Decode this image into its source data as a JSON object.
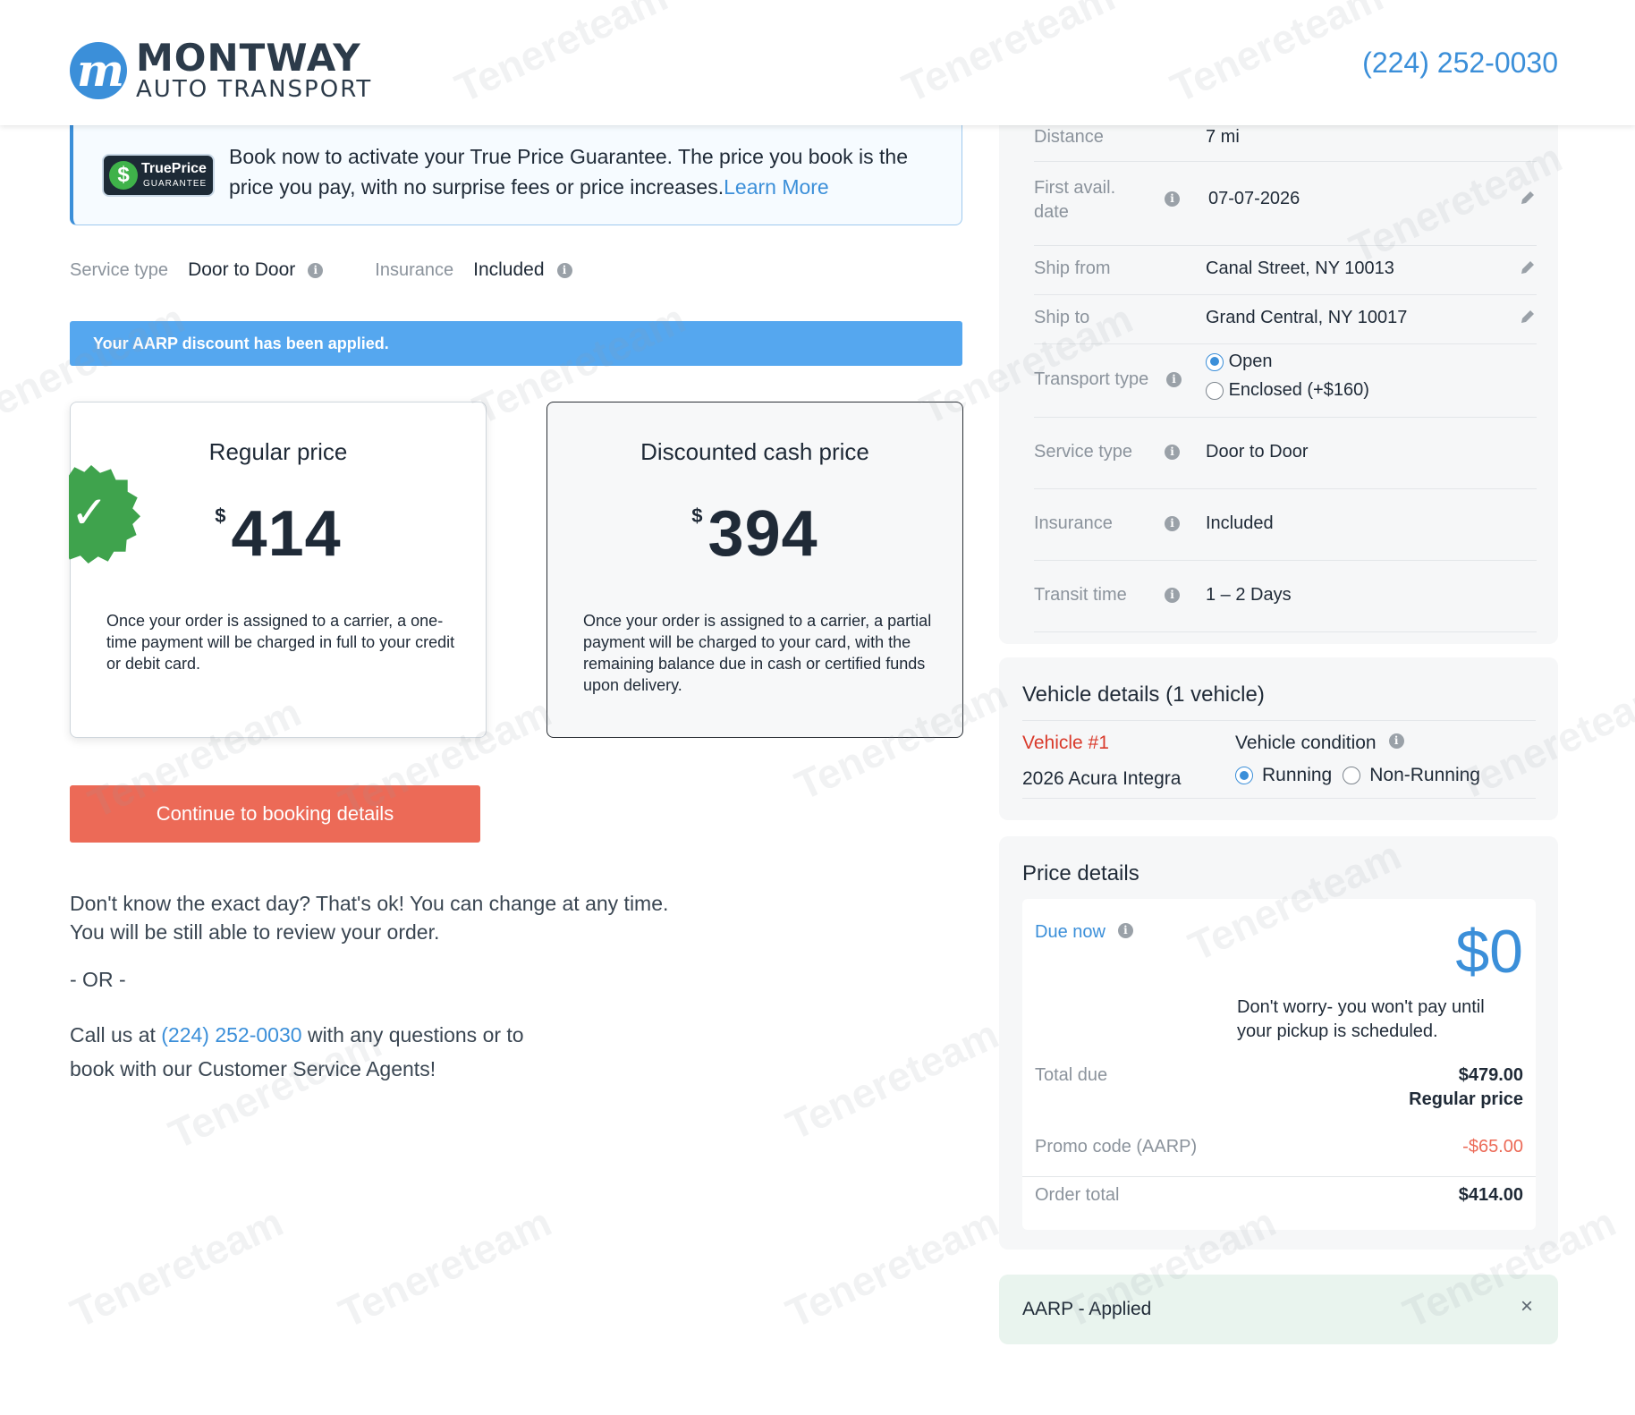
{
  "header": {
    "brand_name": "MONTWAY",
    "brand_sub": "AUTO TRANSPORT",
    "logo_letter": "m",
    "phone": "(224) 252-0030"
  },
  "guarantee": {
    "badge_title": "TruePrice",
    "badge_sub": "GUARANTEE",
    "badge_symbol": "$",
    "text": "Book now to activate your True Price Guarantee. The price you book is the price you pay, with no surprise fees or price increases.",
    "link": "Learn More"
  },
  "service_row": {
    "service_label": "Service type",
    "service_value": "Door to Door",
    "insurance_label": "Insurance",
    "insurance_value": "Included"
  },
  "discount_banner": "Your AARP discount has been applied.",
  "prices": {
    "regular": {
      "title": "Regular price",
      "currency": "$",
      "amount": "414",
      "description": "Once your order is assigned to a carrier, a one-time payment will be charged in full to your credit or debit card.",
      "selected": true
    },
    "discounted": {
      "title": "Discounted cash price",
      "currency": "$",
      "amount": "394",
      "description": "Once your order is assigned to a carrier, a partial payment will be charged to your card, with the remaining balance due in cash or certified funds upon delivery.",
      "selected": false
    }
  },
  "continue_button": "Continue to booking details",
  "help": {
    "line1": "Don't know the exact day? That's ok! You can change at any time.",
    "line2": "You will be still able to review your order.",
    "or": "- OR -",
    "call_prefix": "Call us at ",
    "call_phone": "(224) 252-0030",
    "call_suffix": " with any questions or to book with our Customer Service Agents!"
  },
  "summary": {
    "distance_label": "Distance",
    "distance_value": "7 mi",
    "first_avail_label": "First avail. date",
    "first_avail_value": "07-07-2026",
    "ship_from_label": "Ship from",
    "ship_from_value": "Canal Street, NY 10013",
    "ship_to_label": "Ship to",
    "ship_to_value": "Grand Central, NY 10017",
    "transport_label": "Transport type",
    "transport_options": [
      "Open",
      "Enclosed (+$160)"
    ],
    "transport_selected": "Open",
    "service_label": "Service type",
    "service_value": "Door to Door",
    "insurance_label": "Insurance",
    "insurance_value": "Included",
    "transit_label": "Transit time",
    "transit_value": "1 – 2 Days"
  },
  "vehicle": {
    "title": "Vehicle details (1 vehicle)",
    "number": "Vehicle #1",
    "car": "2026 Acura Integra",
    "condition_label": "Vehicle condition",
    "options": [
      "Running",
      "Non-Running"
    ],
    "selected": "Running"
  },
  "price_details": {
    "title": "Price details",
    "due_label": "Due now",
    "due_amount": "$0",
    "due_note": "Don't worry- you won't pay until your pickup is scheduled.",
    "total_label": "Total due",
    "total_amount": "$479.00",
    "total_sub": "Regular price",
    "promo_label": "Promo code (AARP)",
    "promo_amount": "-$65.00",
    "order_label": "Order total",
    "order_amount": "$414.00"
  },
  "promo_applied": {
    "text": "AARP - Applied",
    "close": "×"
  },
  "watermark": "Tenereteam",
  "colors": {
    "accent_blue": "#3b8fd9",
    "banner_blue": "#55a7ef",
    "cta_orange": "#ec6a57",
    "check_green": "#3fa34d",
    "vehicle_red": "#d93a2b",
    "applied_bg": "#e9f4ee"
  }
}
